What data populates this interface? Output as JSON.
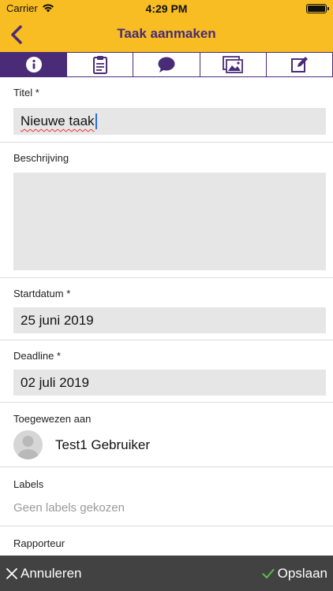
{
  "status": {
    "carrier": "Carrier",
    "time": "4:29 PM"
  },
  "nav": {
    "title": "Taak aanmaken",
    "back_icon": "chevron-left-icon"
  },
  "tabs": [
    {
      "icon": "info-icon",
      "active": true
    },
    {
      "icon": "clipboard-icon",
      "active": false
    },
    {
      "icon": "chat-bubble-icon",
      "active": false
    },
    {
      "icon": "image-gallery-icon",
      "active": false
    },
    {
      "icon": "edit-icon",
      "active": false
    }
  ],
  "form": {
    "title": {
      "label": "Titel *",
      "value": "Nieuwe taak"
    },
    "description": {
      "label": "Beschrijving",
      "value": ""
    },
    "start_date": {
      "label": "Startdatum *",
      "value": "25 juni 2019"
    },
    "deadline": {
      "label": "Deadline *",
      "value": "02 juli 2019"
    },
    "assigned": {
      "label": "Toegewezen aan",
      "user": "Test1 Gebruiker"
    },
    "labels": {
      "label": "Labels",
      "empty_text": "Geen labels gekozen"
    },
    "reporter": {
      "label": "Rapporteur"
    }
  },
  "footer": {
    "cancel_label": "Annuleren",
    "save_label": "Opslaan"
  },
  "colors": {
    "accent": "#f7bd22",
    "brand": "#4a2b78",
    "footer": "#424242",
    "field": "#e6e6e6",
    "save_check": "#5cc14a"
  }
}
